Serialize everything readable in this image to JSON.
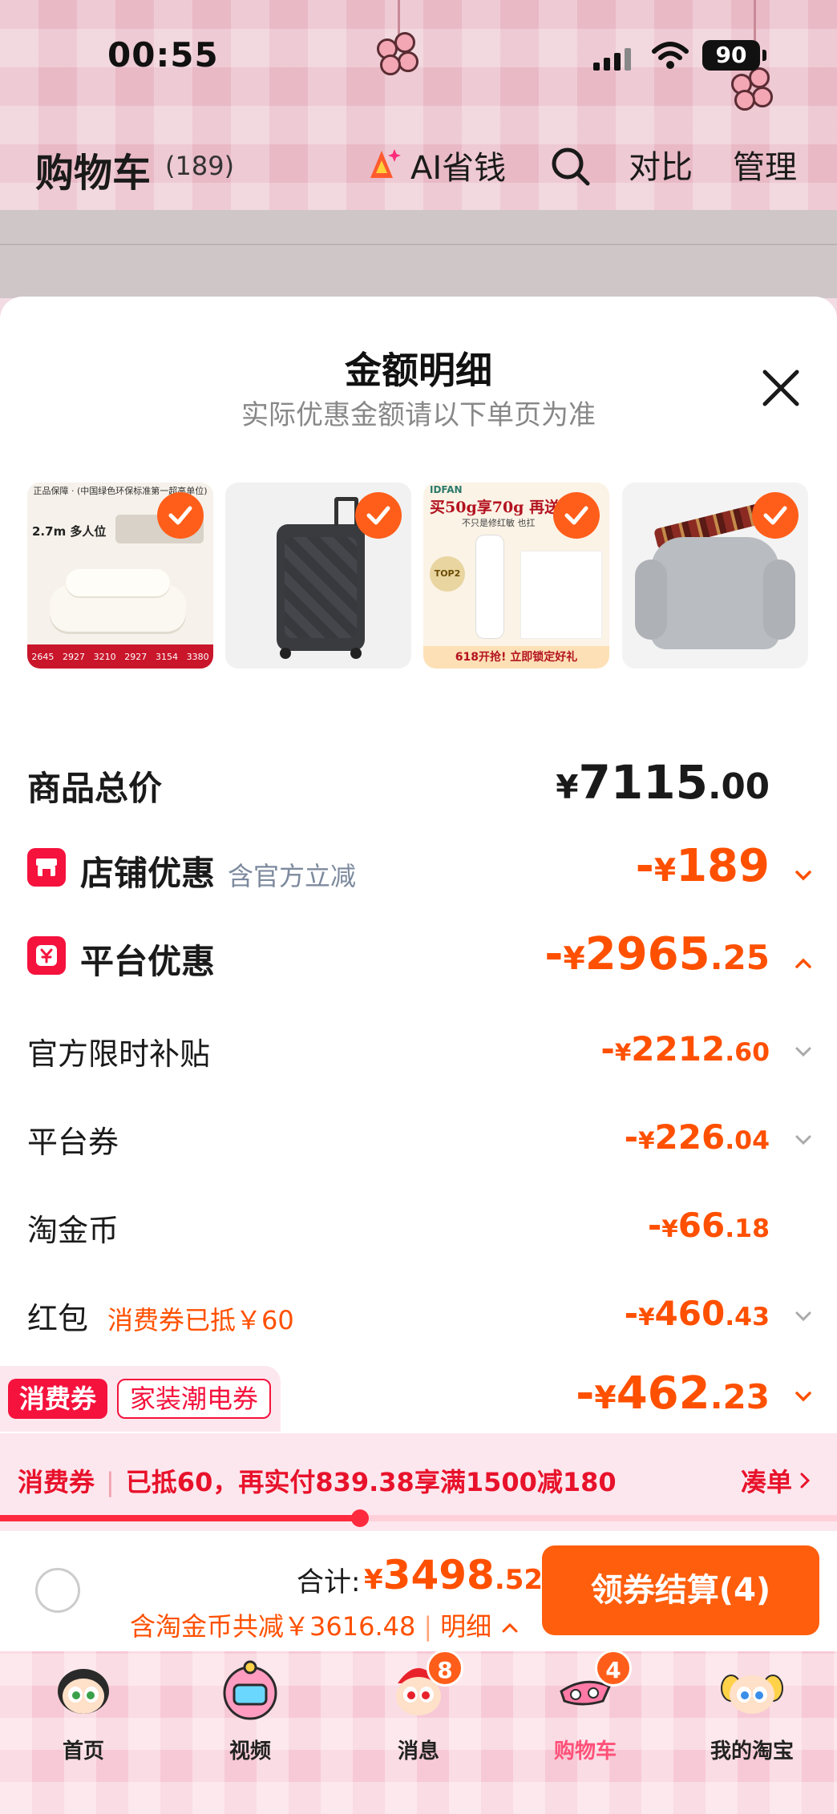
{
  "status_bar": {
    "time": "00:55",
    "battery": "90"
  },
  "header": {
    "title": "购物车",
    "count": "(189)",
    "ai_label": "AI省钱",
    "compare_label": "对比",
    "manage_label": "管理"
  },
  "sheet": {
    "title": "金额明细",
    "subtitle": "实际优惠金额请以下单页为准",
    "products": [
      {
        "kind": "sofa",
        "text_lines": [
          "正品保障 · (中国绿色环保标准第一超高单位)",
          "2.7m 多人位",
          "2645",
          "2927",
          "3210",
          "2927",
          "3154",
          "3380"
        ]
      },
      {
        "kind": "suitcase"
      },
      {
        "kind": "skincare",
        "text_lines": [
          "IDFAN",
          "买50g享70g 再送",
          "不只是修红敏 也扛",
          "TOP2",
          "618开抢! 立即锁定好礼"
        ]
      },
      {
        "kind": "sweater"
      }
    ]
  },
  "rows": {
    "total_goods": {
      "label": "商品总价",
      "yen": "¥",
      "int": "7115",
      "dec": ".00"
    },
    "store_discount": {
      "label": "店铺优惠",
      "note": "含官方立减",
      "minus": "-",
      "yen": "¥",
      "int": "189",
      "dec": ""
    },
    "platform_discount": {
      "label": "平台优惠",
      "minus": "-",
      "yen": "¥",
      "int": "2965",
      "dec": ".25"
    },
    "official_subsidy": {
      "label": "官方限时补贴",
      "minus": "-",
      "yen": "¥",
      "int": "2212",
      "dec": ".60"
    },
    "platform_coupon": {
      "label": "平台券",
      "minus": "-",
      "yen": "¥",
      "int": "226",
      "dec": ".04"
    },
    "tao_coin": {
      "label": "淘金币",
      "minus": "-",
      "yen": "¥",
      "int": "66",
      "dec": ".18"
    },
    "red_packet": {
      "label": "红包",
      "note": "消费券已抵￥60",
      "minus": "-",
      "yen": "¥",
      "int": "460",
      "dec": ".43"
    },
    "consumption_coupon": {
      "tag_primary": "消费券",
      "tag_secondary": "家装潮电券",
      "minus": "-",
      "yen": "¥",
      "int": "462",
      "dec": ".23"
    }
  },
  "coupon_bar": {
    "tag": "消费券",
    "text": "已抵60，再实付839.38享满1500减180",
    "action": "凑单",
    "progress_fraction": 0.43
  },
  "checkout": {
    "total_label": "合计:",
    "total_yen": "¥",
    "total_int": "3498",
    "total_dec": ".52",
    "subtitle": "含淘金币共减￥3616.48",
    "detail_label": "明细",
    "pay_button": "领券结算(4)"
  },
  "tabbar": {
    "tabs": [
      {
        "label": "首页",
        "badge": ""
      },
      {
        "label": "视频",
        "badge": ""
      },
      {
        "label": "消息",
        "badge": "8"
      },
      {
        "label": "购物车",
        "badge": "4",
        "active": true
      },
      {
        "label": "我的淘宝",
        "badge": ""
      }
    ]
  },
  "colors": {
    "accent_orange": "#ff5000",
    "button_orange": "#ff5e0d",
    "badge_red": "#f5123d",
    "active_tab_pink": "#ff5078"
  },
  "icons": [
    "search-icon",
    "ai-sparkle-icon",
    "close-icon",
    "check-icon",
    "store-icon",
    "platform-yen-icon",
    "chevron-down-icon",
    "chevron-up-icon",
    "chevron-right-icon"
  ]
}
